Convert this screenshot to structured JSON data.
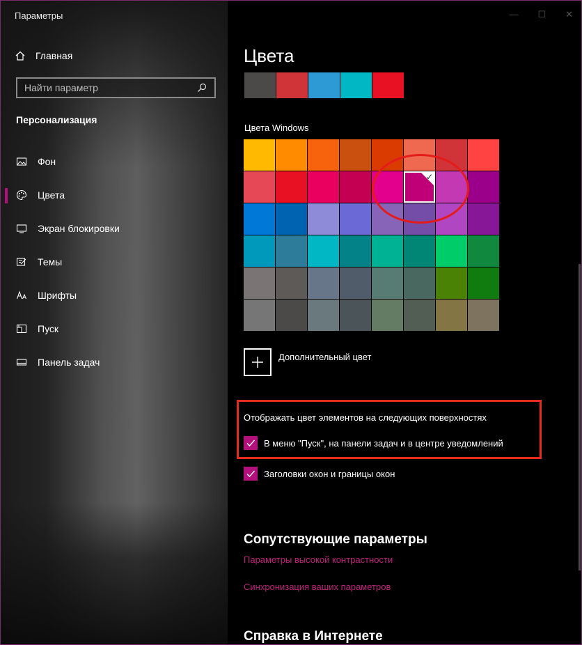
{
  "window": {
    "title": "Параметры",
    "border_color": "#7a2a6e"
  },
  "sidebar": {
    "home_label": "Главная",
    "search_placeholder": "Найти параметр",
    "section_title": "Персонализация",
    "items": [
      {
        "label": "Фон",
        "icon": "image-icon"
      },
      {
        "label": "Цвета",
        "icon": "palette-icon",
        "active": true
      },
      {
        "label": "Экран блокировки",
        "icon": "lock-screen-icon"
      },
      {
        "label": "Темы",
        "icon": "themes-icon"
      },
      {
        "label": "Шрифты",
        "icon": "fonts-icon"
      },
      {
        "label": "Пуск",
        "icon": "start-icon"
      },
      {
        "label": "Панель задач",
        "icon": "taskbar-icon"
      }
    ]
  },
  "main": {
    "page_title": "Цвета",
    "recent_colors": [
      "#4c4a48",
      "#d13438",
      "#2d9ad6",
      "#00b7c3",
      "#e81123"
    ],
    "windows_colors_label": "Цвета Windows",
    "windows_colors": [
      "#ffb900",
      "#ff8c00",
      "#f7630c",
      "#ca5010",
      "#da3b01",
      "#ef6950",
      "#d13438",
      "#ff4343",
      "#e74856",
      "#e81123",
      "#ea005e",
      "#c30052",
      "#e3008c",
      "#bf0077",
      "#c239b3",
      "#9a0089",
      "#0078d7",
      "#0063b1",
      "#8e8cd8",
      "#6b69d6",
      "#8764b8",
      "#744da9",
      "#b146c2",
      "#881798",
      "#0099bc",
      "#2d7d9a",
      "#00b7c3",
      "#038387",
      "#00b294",
      "#018574",
      "#00cc6a",
      "#10893e",
      "#7a7574",
      "#5d5a58",
      "#68768a",
      "#515c6b",
      "#567c73",
      "#486860",
      "#498205",
      "#107c10",
      "#767676",
      "#4c4a48",
      "#69797e",
      "#4a5459",
      "#647c64",
      "#525e54",
      "#847545",
      "#7e735f"
    ],
    "selected_color_index": 13,
    "custom_color_label": "Дополнительный цвет",
    "surfaces_label": "Отображать цвет элементов на следующих поверхностях",
    "checkbox_start": {
      "label": "В меню \"Пуск\", на панели задач и в центре уведомлений",
      "checked": true
    },
    "checkbox_titlebars": {
      "label": "Заголовки окон и границы окон",
      "checked": true
    },
    "related_title": "Сопутствующие параметры",
    "link_high_contrast": "Параметры высокой контрастности",
    "link_sync": "Синхронизация ваших параметров",
    "help_title": "Справка в Интернете",
    "accent_color": "#b3107c",
    "link_color": "#c1207e",
    "annotation_color": "#e41b1b"
  }
}
